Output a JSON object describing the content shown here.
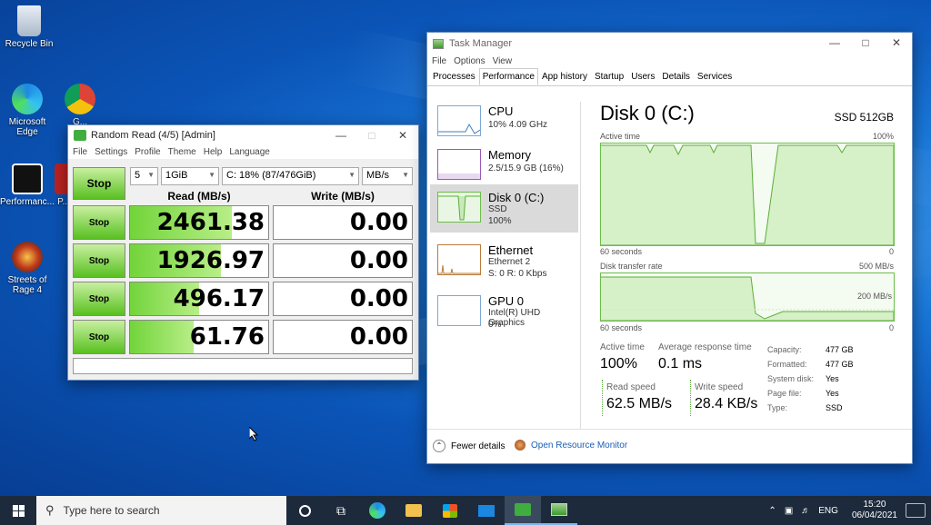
{
  "desktop": {
    "icons": [
      {
        "label": "Recycle Bin"
      },
      {
        "label": "Microsoft Edge"
      },
      {
        "label": "Performanc..."
      },
      {
        "label": "Streets of Rage 4"
      },
      {
        "label": "G..."
      },
      {
        "label": "P..."
      }
    ]
  },
  "bench": {
    "title": "Random Read (4/5) [Admin]",
    "menu": [
      "File",
      "Settings",
      "Profile",
      "Theme",
      "Help",
      "Language"
    ],
    "big_stop": "Stop",
    "count": "5",
    "size": "1GiB",
    "drive": "C: 18% (87/476GiB)",
    "unit": "MB/s",
    "read_header": "Read (MB/s)",
    "write_header": "Write (MB/s)",
    "rows": [
      {
        "stop": "Stop",
        "read": "2461.38",
        "write": "0.00",
        "read_fill": 0.74
      },
      {
        "stop": "Stop",
        "read": "1926.97",
        "write": "0.00",
        "read_fill": 0.66
      },
      {
        "stop": "Stop",
        "read": "496.17",
        "write": "0.00",
        "read_fill": 0.5
      },
      {
        "stop": "Stop",
        "read": "61.76",
        "write": "0.00",
        "read_fill": 0.46
      }
    ]
  },
  "tm": {
    "title": "Task Manager",
    "menu": [
      "File",
      "Options",
      "View"
    ],
    "tabs": [
      "Processes",
      "Performance",
      "App history",
      "Startup",
      "Users",
      "Details",
      "Services"
    ],
    "items": [
      {
        "name": "CPU",
        "sub1": "10% 4.09 GHz",
        "sub2": ""
      },
      {
        "name": "Memory",
        "sub1": "2.5/15.9 GB (16%)",
        "sub2": ""
      },
      {
        "name": "Disk 0 (C:)",
        "sub1": "SSD",
        "sub2": "100%"
      },
      {
        "name": "Ethernet",
        "sub1": "Ethernet 2",
        "sub2": "S: 0 R: 0 Kbps"
      },
      {
        "name": "GPU 0",
        "sub1": "Intel(R) UHD Graphics",
        "sub2": "0%"
      }
    ],
    "disk_title": "Disk 0 (C:)",
    "disk_model": "SSD 512GB",
    "g1_label": "Active time",
    "g1_max": "100%",
    "g1_xl": "60 seconds",
    "g1_xr": "0",
    "g2_label": "Disk transfer rate",
    "g2_max": "500 MB/s",
    "g2_mid": "200 MB/s",
    "g2_xl": "60 seconds",
    "g2_xr": "0",
    "active_time_label": "Active time",
    "active_time": "100%",
    "avg_resp_label": "Average response time",
    "avg_resp": "0.1 ms",
    "read_speed_label": "Read speed",
    "read_speed": "62.5 MB/s",
    "write_speed_label": "Write speed",
    "write_speed": "28.4 KB/s",
    "props": [
      {
        "k": "Capacity:",
        "v": "477 GB"
      },
      {
        "k": "Formatted:",
        "v": "477 GB"
      },
      {
        "k": "System disk:",
        "v": "Yes"
      },
      {
        "k": "Page file:",
        "v": "Yes"
      },
      {
        "k": "Type:",
        "v": "SSD"
      }
    ],
    "fewer": "Fewer details",
    "resmon": "Open Resource Monitor"
  },
  "taskbar": {
    "search_placeholder": "Type here to search",
    "lang": "ENG",
    "time": "15:20",
    "date": "06/04/2021"
  }
}
